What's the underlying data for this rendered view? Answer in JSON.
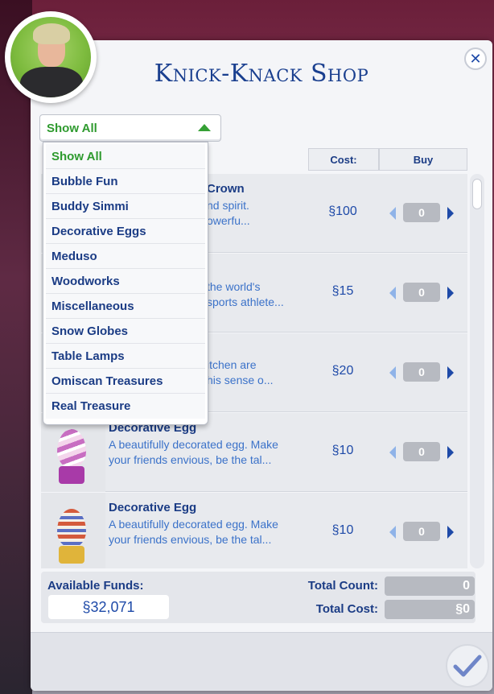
{
  "window": {
    "title": "Knick-Knack Shop",
    "close_icon": "close-icon"
  },
  "filter": {
    "selected": "Show All",
    "options": [
      "Show All",
      "Bubble Fun",
      "Buddy Simmi",
      "Decorative Eggs",
      "Meduso",
      "Woodworks",
      "Miscellaneous",
      "Snow Globes",
      "Table Lamps",
      "Omiscan Treasures",
      "Real Treasure"
    ]
  },
  "columns": {
    "cost": "Cost:",
    "buy": "Buy"
  },
  "items": [
    {
      "name": "Crown",
      "desc_line1": "nd spirit.",
      "desc_line2": "owerfu...",
      "cost": "§100",
      "qty": "0"
    },
    {
      "name": "",
      "desc_line1": "the world's",
      "desc_line2": "sports athlete...",
      "cost": "§15",
      "qty": "0"
    },
    {
      "name": "",
      "desc_line1": "itchen are",
      "desc_line2": "his sense o...",
      "cost": "§20",
      "qty": "0"
    },
    {
      "name": "Decorative Egg",
      "desc_line1": "A beautifully decorated egg. Make",
      "desc_line2": "your friends envious, be the tal...",
      "cost": "§10",
      "qty": "0"
    },
    {
      "name": "Decorative Egg",
      "desc_line1": "A beautifully decorated egg. Make",
      "desc_line2": "your friends envious, be the tal...",
      "cost": "§10",
      "qty": "0"
    }
  ],
  "funds": {
    "label": "Available Funds:",
    "value": "§32,071"
  },
  "totals": {
    "count_label": "Total Count:",
    "count_value": "0",
    "cost_label": "Total Cost:",
    "cost_value": "§0"
  },
  "colors": {
    "accent_blue": "#1b3c85",
    "link_blue": "#3b72c9",
    "selected_green": "#2e9a2e"
  }
}
